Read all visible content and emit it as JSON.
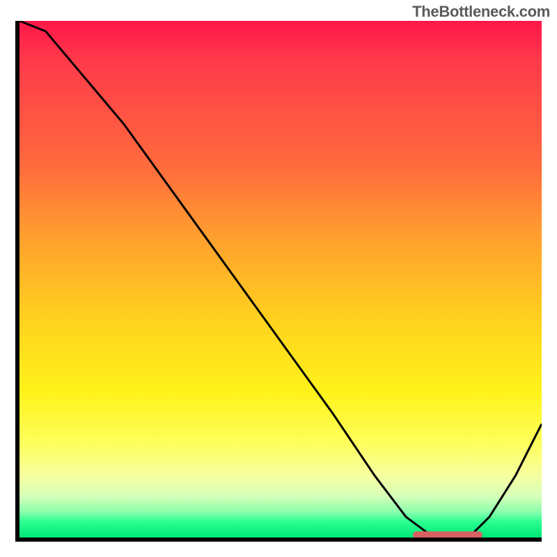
{
  "watermark": "TheBottleneck.com",
  "chart_data": {
    "type": "line",
    "title": "",
    "xlabel": "",
    "ylabel": "",
    "xlim": [
      0,
      100
    ],
    "ylim": [
      0,
      100
    ],
    "grid": false,
    "series": [
      {
        "name": "bottleneck-curve",
        "x": [
          0,
          5,
          20,
          30,
          40,
          50,
          60,
          68,
          74,
          78,
          82,
          86,
          90,
          95,
          100
        ],
        "values": [
          100,
          98,
          80,
          66,
          52,
          38,
          24,
          12,
          4,
          1,
          0,
          0,
          4,
          12,
          22
        ]
      }
    ],
    "annotations": [
      {
        "name": "optimal-marker",
        "type": "segment",
        "x0": 76,
        "x1": 88,
        "y": 0.5,
        "color": "#d86060"
      }
    ],
    "background_gradient": {
      "top": "#ff174a",
      "mid_upper": "#ffa02e",
      "mid": "#fff31a",
      "mid_lower": "#f6ffa0",
      "bottom": "#00e878"
    }
  }
}
